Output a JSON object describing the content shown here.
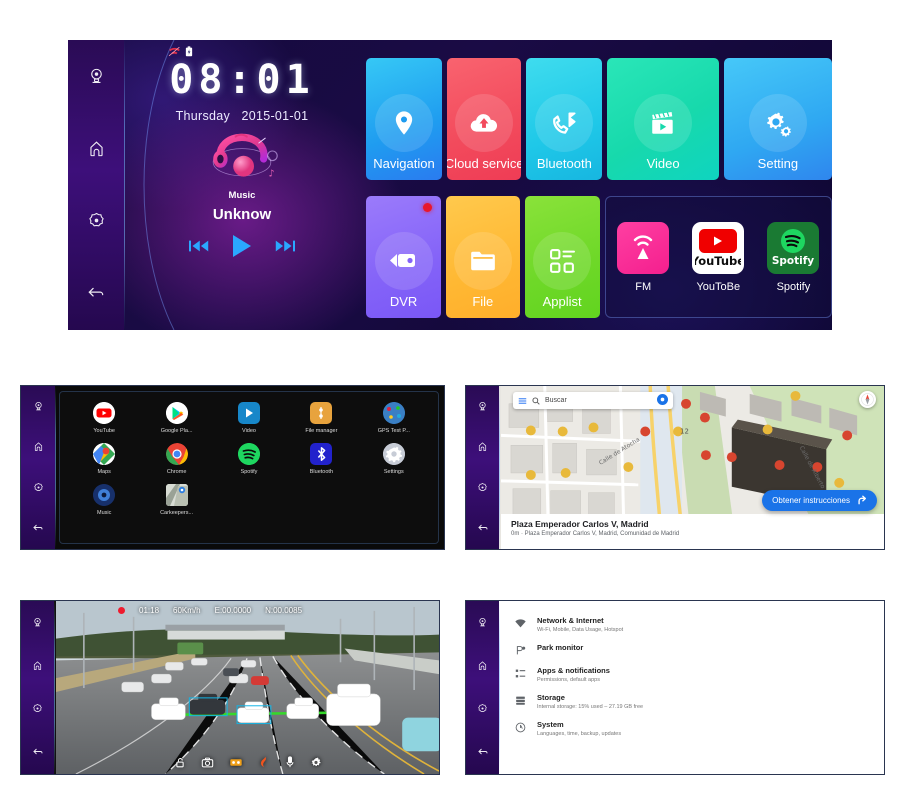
{
  "main_screen": {
    "status": {
      "signal_icon": "signal-off-icon",
      "battery_icon": "battery-icon"
    },
    "clock": {
      "time": "08:01",
      "weekday": "Thursday",
      "date": "2015-01-01"
    },
    "music": {
      "source_label": "Music",
      "track_title": "Unknow",
      "prev_icon": "previous-track-icon",
      "play_icon": "play-icon",
      "next_icon": "next-track-icon"
    },
    "sidebar": [
      {
        "name": "camera",
        "icon": "camera-icon"
      },
      {
        "name": "home",
        "icon": "home-icon"
      },
      {
        "name": "settings",
        "icon": "settings-flower-icon"
      },
      {
        "name": "back",
        "icon": "back-arrow-icon"
      }
    ],
    "tiles_row1": [
      {
        "label": "Navigation",
        "icon": "map-pin-icon",
        "color": "#1f9cf0"
      },
      {
        "label": "Cloud service",
        "icon": "cloud-upload-icon",
        "color": "#f24a5c"
      },
      {
        "label": "Bluetooth",
        "icon": "bluetooth-phone-icon",
        "color": "#1fc8e8"
      },
      {
        "label": "Video",
        "icon": "clapperboard-play-icon",
        "color": "#17d9ac"
      },
      {
        "label": "Setting",
        "icon": "gears-icon",
        "color": "#2fa8f2"
      }
    ],
    "tiles_row2": [
      {
        "label": "DVR",
        "icon": "dashcam-icon",
        "color": "#8463f8",
        "badge": true
      },
      {
        "label": "File",
        "icon": "folder-icon",
        "color": "#ffb833",
        "badge": false
      },
      {
        "label": "Applist",
        "icon": "app-grid-icon",
        "color": "#6ed828",
        "badge": false
      }
    ],
    "shortcut_group": [
      {
        "label": "FM",
        "icon": "fm-radio-icon",
        "color": "#f41f8e"
      },
      {
        "label": "YouToBe",
        "icon": "youtube-icon",
        "color": "#ffffff"
      },
      {
        "label": "Spotify",
        "icon": "spotify-icon",
        "color": "#1a7a33"
      }
    ]
  },
  "app_drawer": {
    "apps": [
      {
        "label": "YouTube",
        "icon": "youtube-icon"
      },
      {
        "label": "Google Pla...",
        "icon": "google-play-icon"
      },
      {
        "label": "Video",
        "icon": "video-player-icon"
      },
      {
        "label": "File manager",
        "icon": "file-manager-icon"
      },
      {
        "label": "GPS Test P...",
        "icon": "gps-test-icon"
      },
      {
        "label": "Maps",
        "icon": "google-maps-icon"
      },
      {
        "label": "Chrome",
        "icon": "chrome-icon"
      },
      {
        "label": "Spotify",
        "icon": "spotify-icon"
      },
      {
        "label": "Bluetooth",
        "icon": "bluetooth-icon"
      },
      {
        "label": "Settings",
        "icon": "settings-gear-icon"
      },
      {
        "label": "Music",
        "icon": "music-icon"
      },
      {
        "label": "Carkeepers...",
        "icon": "carkeepers-icon"
      }
    ]
  },
  "maps_screen": {
    "search": {
      "placeholder": "Buscar",
      "menu_icon": "hamburger-menu-icon",
      "search_icon": "search-icon",
      "voice_icon": "assistant-icon"
    },
    "compass_icon": "compass-icon",
    "place": {
      "title": "Plaza Emperador Carlos V, Madrid",
      "subtitle": "0m · Plaza Emperador Carlos V, Madrid, Comunidad de Madrid"
    },
    "cta": {
      "label": "Obtener instrucciones",
      "icon": "directions-arrow-icon"
    },
    "street_labels": [
      "Calle de Atocha",
      "Calle de Alberto",
      "12"
    ]
  },
  "dvr_screen": {
    "osd": {
      "recording_indicator": "record-dot-icon",
      "timer": "01:18",
      "speed": "60Km/h",
      "longitude": "E:00.0000",
      "latitude": "N:00.0085"
    },
    "controls": [
      {
        "name": "lock",
        "icon": "lock-icon"
      },
      {
        "name": "photo",
        "icon": "camera-shutter-icon"
      },
      {
        "name": "gallery",
        "icon": "video-gallery-icon"
      },
      {
        "name": "record",
        "icon": "record-icon"
      },
      {
        "name": "mic",
        "icon": "microphone-icon"
      },
      {
        "name": "settings",
        "icon": "gear-icon"
      }
    ]
  },
  "settings_screen": {
    "items": [
      {
        "title": "Network & Internet",
        "subtitle": "Wi-Fi, Mobile, Data Usage, Hotspot",
        "icon": "wifi-icon"
      },
      {
        "title": "Park monitor",
        "subtitle": "",
        "icon": "park-monitor-icon"
      },
      {
        "title": "Apps & notifications",
        "subtitle": "Permissions, default apps",
        "icon": "apps-list-icon"
      },
      {
        "title": "Storage",
        "subtitle": "Internal storage: 15% used – 27.19 GB free",
        "icon": "storage-icon"
      },
      {
        "title": "System",
        "subtitle": "Languages, time, backup, updates",
        "icon": "info-circle-icon"
      }
    ]
  }
}
